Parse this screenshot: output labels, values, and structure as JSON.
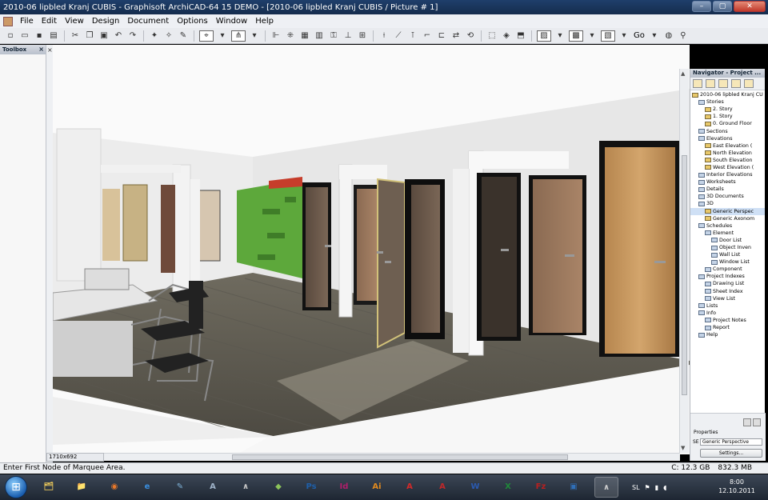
{
  "window": {
    "title": "2010-06 lipbled Kranj CUBIS - Graphisoft ArchiCAD-64 15 DEMO - [2010-06 lipbled Kranj CUBIS / Picture # 1]",
    "min_label": "–",
    "max_label": "▢",
    "close_label": "✕"
  },
  "menu": {
    "items": [
      "File",
      "Edit",
      "View",
      "Design",
      "Document",
      "Options",
      "Window",
      "Help"
    ]
  },
  "toolbar": {
    "go_label": "Go"
  },
  "toolbox": {
    "title": "Toolbox",
    "close_label": "×",
    "gap_label": "×"
  },
  "viewport": {
    "size_label": "1710x692"
  },
  "navigator": {
    "title": "Navigator - Project ...",
    "tree": [
      {
        "label": "2010-06 lipbled Kranj CU",
        "indent": 0,
        "icon": "folder"
      },
      {
        "label": "Stories",
        "indent": 1,
        "icon": "view"
      },
      {
        "label": "2. Story",
        "indent": 2,
        "icon": "folder"
      },
      {
        "label": "1. Story",
        "indent": 2,
        "icon": "folder"
      },
      {
        "label": "0. Ground Floor",
        "indent": 2,
        "icon": "folder"
      },
      {
        "label": "Sections",
        "indent": 1,
        "icon": "view"
      },
      {
        "label": "Elevations",
        "indent": 1,
        "icon": "view"
      },
      {
        "label": "East Elevation (",
        "indent": 2,
        "icon": "folder"
      },
      {
        "label": "North Elevation",
        "indent": 2,
        "icon": "folder"
      },
      {
        "label": "South Elevation",
        "indent": 2,
        "icon": "folder"
      },
      {
        "label": "West Elevation (",
        "indent": 2,
        "icon": "folder"
      },
      {
        "label": "Interior Elevations",
        "indent": 1,
        "icon": "view"
      },
      {
        "label": "Worksheets",
        "indent": 1,
        "icon": "view"
      },
      {
        "label": "Details",
        "indent": 1,
        "icon": "view"
      },
      {
        "label": "3D Documents",
        "indent": 1,
        "icon": "view"
      },
      {
        "label": "3D",
        "indent": 1,
        "icon": "view"
      },
      {
        "label": "Generic Perspec",
        "indent": 2,
        "icon": "folder",
        "selected": true
      },
      {
        "label": "Generic Axonom",
        "indent": 2,
        "icon": "folder"
      },
      {
        "label": "Schedules",
        "indent": 1,
        "icon": "view"
      },
      {
        "label": "Element",
        "indent": 2,
        "icon": "view"
      },
      {
        "label": "Door List",
        "indent": 3,
        "icon": "view"
      },
      {
        "label": "Object Inven",
        "indent": 3,
        "icon": "view"
      },
      {
        "label": "Wall List",
        "indent": 3,
        "icon": "view"
      },
      {
        "label": "Window List",
        "indent": 3,
        "icon": "view"
      },
      {
        "label": "Component",
        "indent": 2,
        "icon": "view"
      },
      {
        "label": "Project Indexes",
        "indent": 1,
        "icon": "view"
      },
      {
        "label": "Drawing List",
        "indent": 2,
        "icon": "view"
      },
      {
        "label": "Sheet Index",
        "indent": 2,
        "icon": "view"
      },
      {
        "label": "View List",
        "indent": 2,
        "icon": "view"
      },
      {
        "label": "Lists",
        "indent": 1,
        "icon": "view"
      },
      {
        "label": "Info",
        "indent": 1,
        "icon": "view"
      },
      {
        "label": "Project Notes",
        "indent": 2,
        "icon": "view"
      },
      {
        "label": "Report",
        "indent": 2,
        "icon": "view"
      },
      {
        "label": "Help",
        "indent": 1,
        "icon": "view"
      }
    ],
    "properties_label": "Properties",
    "properties_id": "SE",
    "properties_value": "Generic Perspective",
    "settings_label": "Settings..."
  },
  "status": {
    "message": "Enter First Node of Marquee Area.",
    "disk": "C: 12.3 GB",
    "memory": "832.3 MB"
  },
  "taskbar": {
    "apps": [
      {
        "name": "explorer",
        "glyph": "🗂",
        "color": "#e8c65a"
      },
      {
        "name": "folder",
        "glyph": "📁",
        "color": "#e6c36a"
      },
      {
        "name": "firefox",
        "glyph": "◉",
        "color": "#e8782a"
      },
      {
        "name": "internet-explorer",
        "glyph": "e",
        "color": "#3a8fe0"
      },
      {
        "name": "app-pen",
        "glyph": "✎",
        "color": "#7fb3d9"
      },
      {
        "name": "app-a",
        "glyph": "A",
        "color": "#9fb3c9"
      },
      {
        "name": "archicad",
        "glyph": "∧",
        "color": "#c9c9c9"
      },
      {
        "name": "sketch",
        "glyph": "◆",
        "color": "#8cc45a"
      },
      {
        "name": "photoshop",
        "glyph": "Ps",
        "color": "#1f5fa8"
      },
      {
        "name": "indesign",
        "glyph": "Id",
        "color": "#b21e6b"
      },
      {
        "name": "illustrator",
        "glyph": "Ai",
        "color": "#e08a1f"
      },
      {
        "name": "acrobat",
        "glyph": "A",
        "color": "#d22a2a"
      },
      {
        "name": "acrobat-reader",
        "glyph": "A",
        "color": "#c0282a"
      },
      {
        "name": "word",
        "glyph": "W",
        "color": "#2a5ab0"
      },
      {
        "name": "excel",
        "glyph": "X",
        "color": "#1f8a3a"
      },
      {
        "name": "filezilla",
        "glyph": "Fz",
        "color": "#b72020"
      },
      {
        "name": "virtualbox",
        "glyph": "▣",
        "color": "#2f6fb8"
      },
      {
        "name": "archicad-active",
        "glyph": "∧",
        "color": "#d0d0d0",
        "active": true
      }
    ],
    "language": "SL",
    "time": "8:00",
    "date": "12.10.2011"
  }
}
